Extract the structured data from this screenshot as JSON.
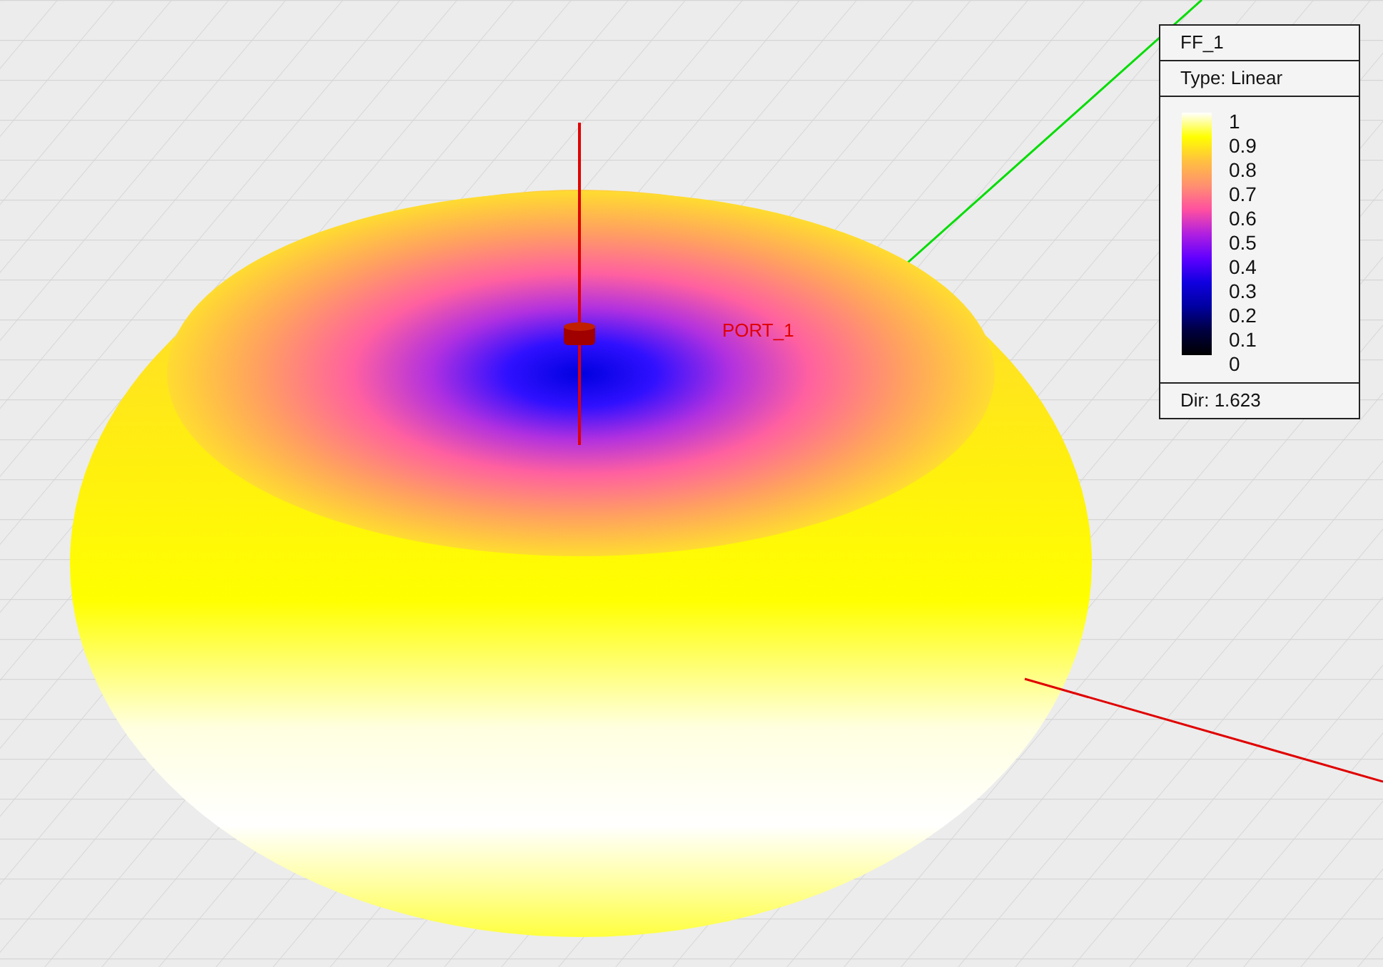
{
  "legend": {
    "title": "FF_1",
    "type_label": "Type: Linear",
    "ticks": [
      "1",
      "0.9",
      "0.8",
      "0.7",
      "0.6",
      "0.5",
      "0.4",
      "0.3",
      "0.2",
      "0.1",
      "0"
    ],
    "directivity": "Dir: 1.623"
  },
  "port": {
    "label": "PORT_1"
  }
}
